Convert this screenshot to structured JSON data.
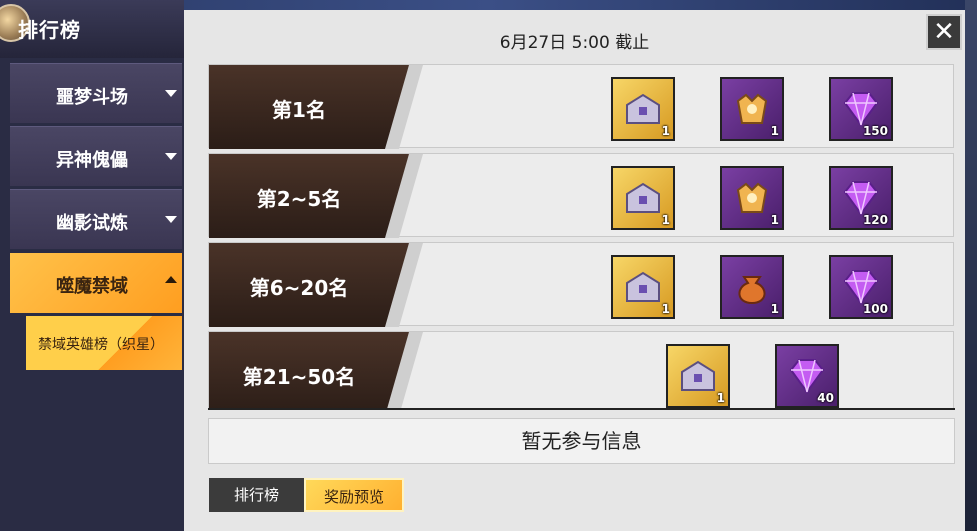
{
  "sidebar": {
    "title": "排行榜",
    "items": [
      {
        "label": "噩梦斗场"
      },
      {
        "label": "异神傀儡"
      },
      {
        "label": "幽影试炼"
      },
      {
        "label": "噬魔禁域"
      }
    ],
    "sub_item": {
      "label": "禁域英雄榜（织星）"
    }
  },
  "panel": {
    "deadline": "6月27日 5:00 截止",
    "close_symbol": "✕",
    "rows": [
      {
        "rank": "第1名",
        "rewards": [
          {
            "icon": "silver-chest-icon",
            "count": "1"
          },
          {
            "icon": "golden-armor-icon",
            "count": "1"
          },
          {
            "icon": "purple-gem-icon",
            "count": "150"
          }
        ]
      },
      {
        "rank": "第2~5名",
        "rewards": [
          {
            "icon": "silver-chest-icon",
            "count": "1"
          },
          {
            "icon": "golden-armor-icon",
            "count": "1"
          },
          {
            "icon": "purple-gem-icon",
            "count": "120"
          }
        ]
      },
      {
        "rank": "第6~20名",
        "rewards": [
          {
            "icon": "silver-chest-icon",
            "count": "1"
          },
          {
            "icon": "orange-pouch-icon",
            "count": "1"
          },
          {
            "icon": "purple-gem-icon",
            "count": "100"
          }
        ]
      },
      {
        "rank": "第21~50名",
        "rewards": [
          {
            "icon": "silver-chest-icon",
            "count": "1"
          },
          {
            "icon": "purple-gem-icon",
            "count": "40"
          }
        ]
      }
    ],
    "no_info": "暂无参与信息",
    "tabs": {
      "ranking": "排行榜",
      "rewards": "奖励预览"
    }
  },
  "colors": {
    "accent": "#ffb030",
    "rank_bg": "#3a2a22",
    "gem": "#b44ae6"
  }
}
